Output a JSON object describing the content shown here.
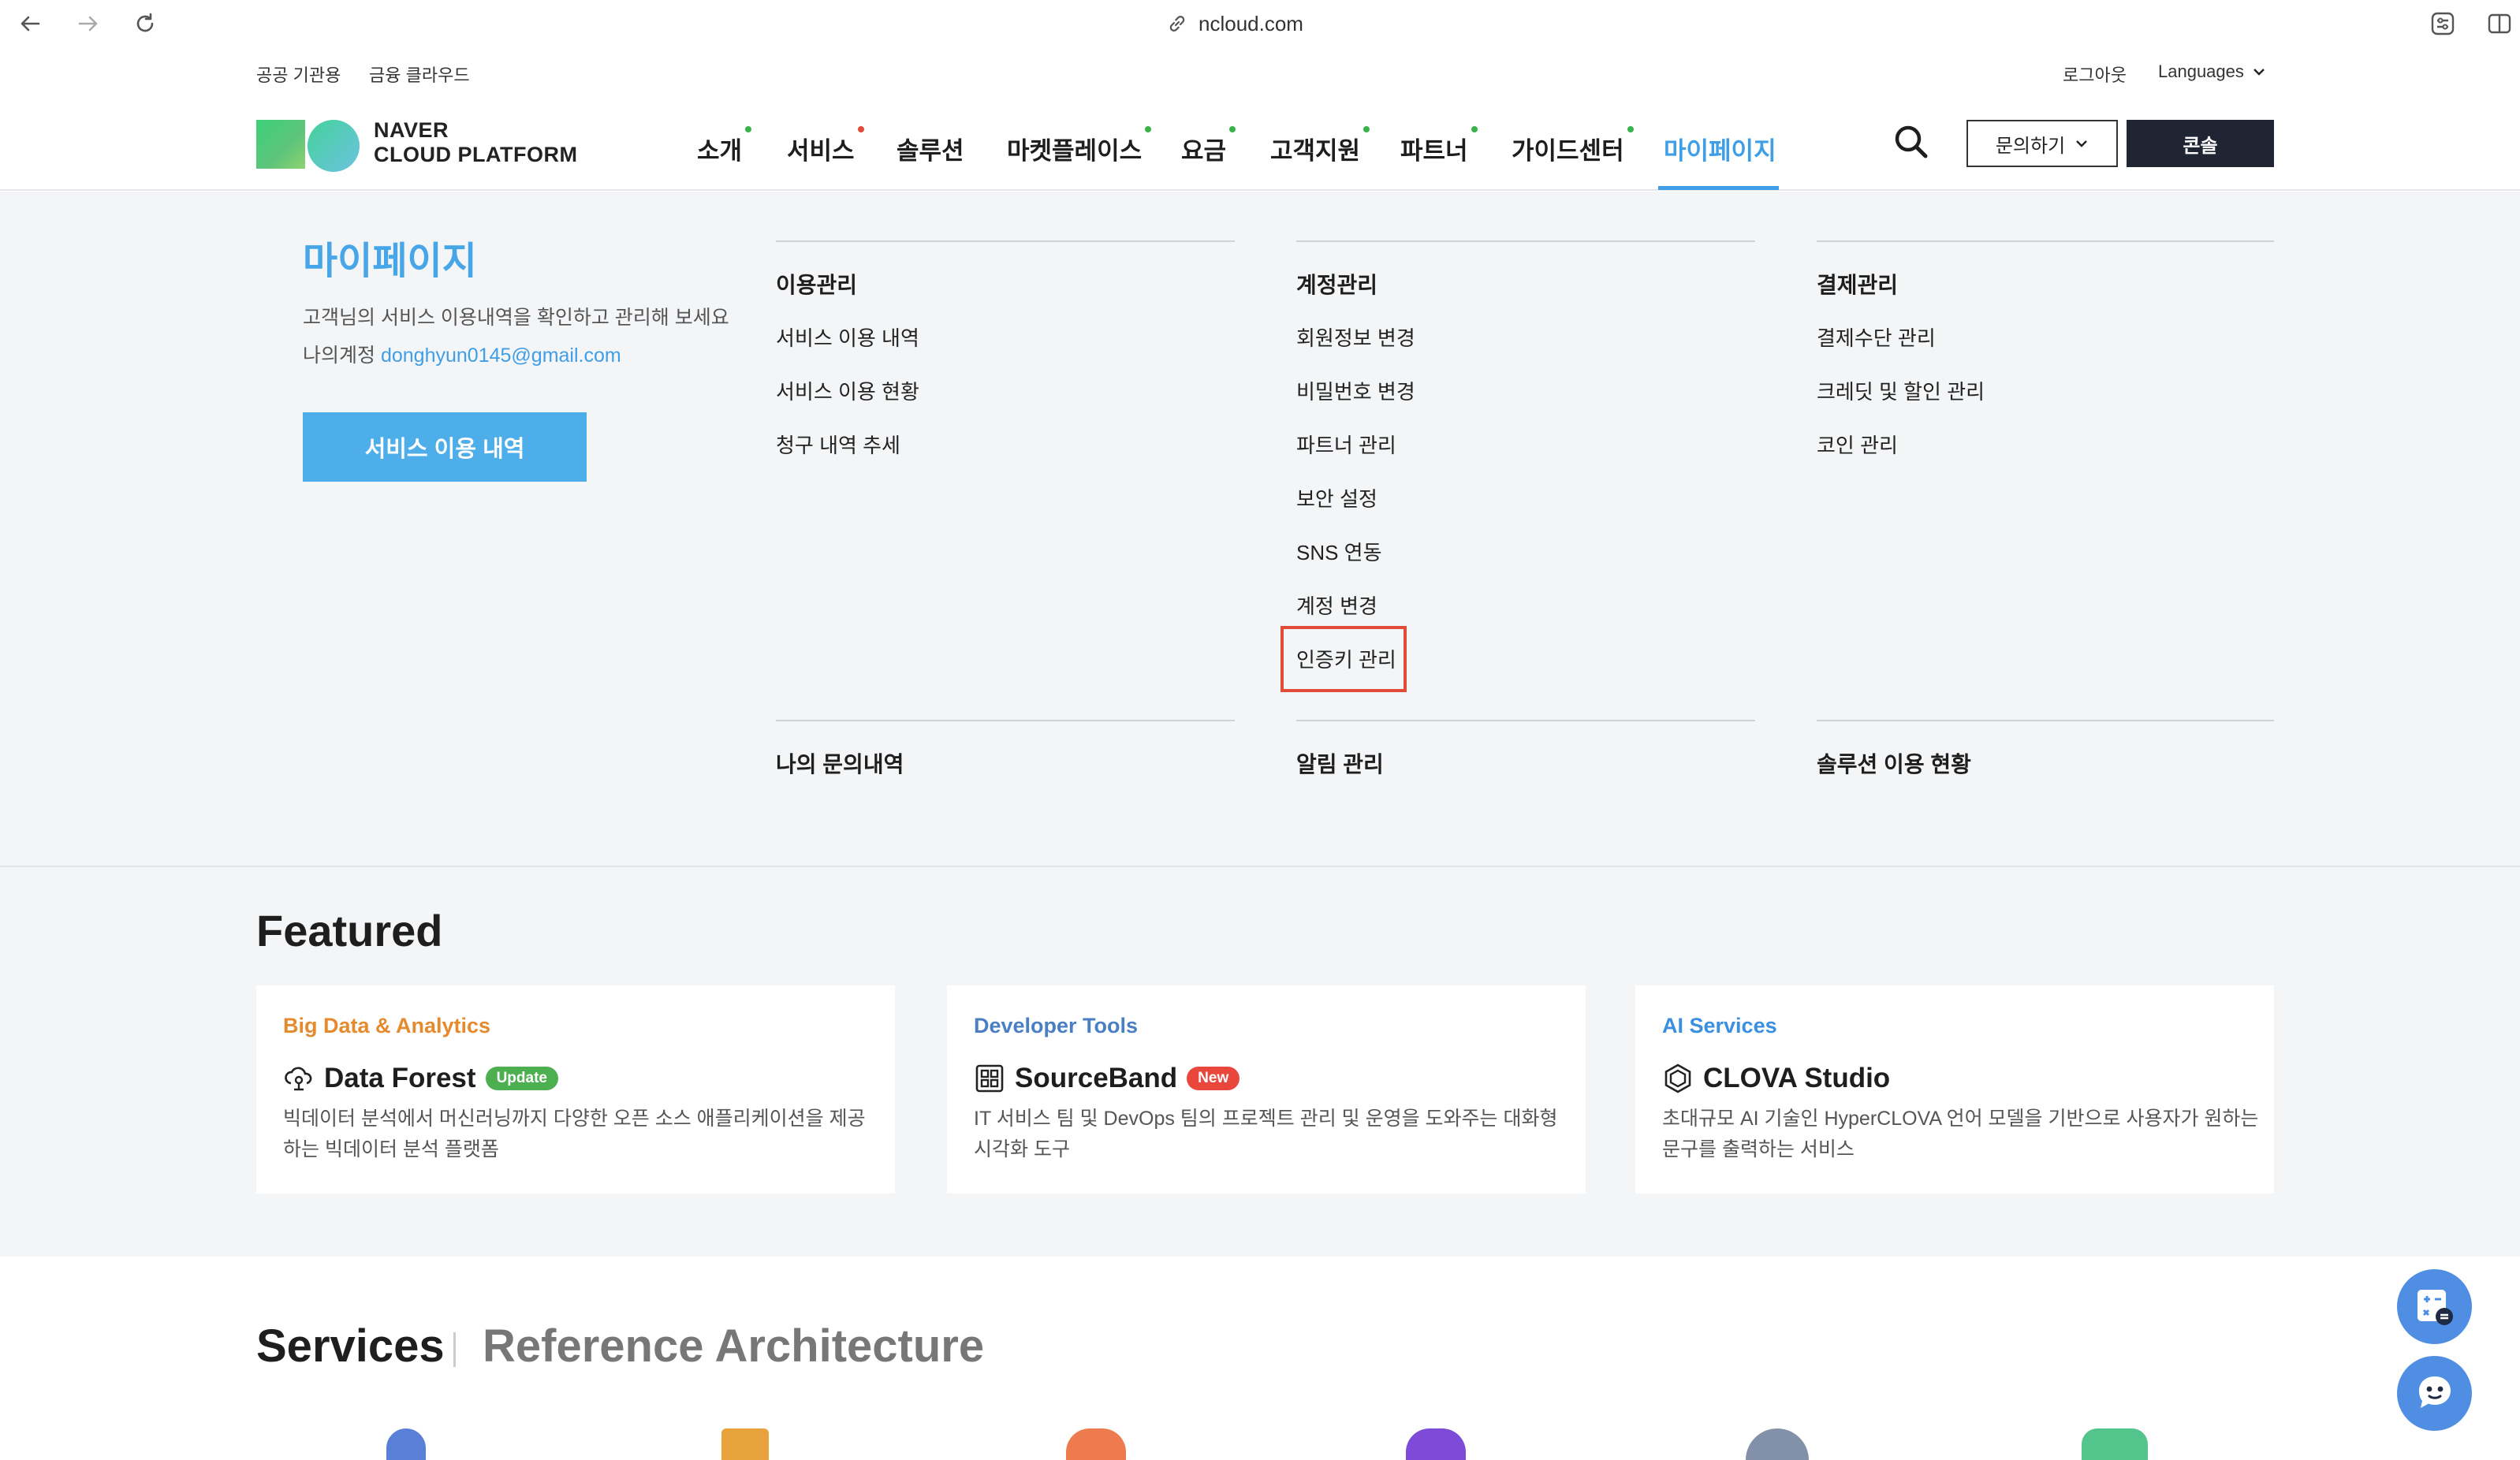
{
  "browser": {
    "url": "ncloud.com"
  },
  "utility": {
    "left_links": [
      "공공 기관용",
      "금융 클라우드"
    ],
    "logout": "로그아웃",
    "languages": "Languages"
  },
  "header": {
    "logo_line1": "NAVER",
    "logo_line2": "CLOUD PLATFORM",
    "menu": [
      {
        "label": "소개",
        "dot": "#38b24a"
      },
      {
        "label": "서비스",
        "dot": "#e04b3a"
      },
      {
        "label": "솔루션",
        "dot": ""
      },
      {
        "label": "마켓플레이스",
        "dot": "#38b24a"
      },
      {
        "label": "요금",
        "dot": "#38b24a"
      },
      {
        "label": "고객지원",
        "dot": "#38b24a"
      },
      {
        "label": "파트너",
        "dot": "#38b24a"
      },
      {
        "label": "가이드센터",
        "dot": "#38b24a"
      },
      {
        "label": "마이페이지",
        "dot": ""
      }
    ],
    "inquiry_label": "문의하기",
    "console_label": "콘솔",
    "accent_color": "#3f9ee6"
  },
  "mypage": {
    "title": "마이페이지",
    "desc": "고객님의 서비스 이용내역을 확인하고 관리해 보세요",
    "account_label": "나의계정",
    "account_email": "donghyun0145@gmail.com",
    "button_label": "서비스 이용 내역",
    "columns": [
      {
        "heading": "이용관리",
        "items": [
          "서비스 이용 내역",
          "서비스 이용 현황",
          "청구 내역 추세"
        ]
      },
      {
        "heading": "계정관리",
        "items": [
          "회원정보 변경",
          "비밀번호 변경",
          "파트너 관리",
          "보안 설정",
          "SNS 연동",
          "계정 변경",
          "인증키 관리"
        ]
      },
      {
        "heading": "결제관리",
        "items": [
          "결제수단 관리",
          "크레딧 및 할인 관리",
          "코인 관리"
        ]
      }
    ],
    "bottom_links": [
      "나의 문의내역",
      "알림 관리",
      "솔루션 이용 현황"
    ]
  },
  "featured": {
    "title": "Featured",
    "cards": [
      {
        "category": "Big Data & Analytics",
        "category_color": "#e68a2e",
        "name": "Data Forest",
        "badge": "Update",
        "badge_color": "#4caf50",
        "icon": "cloud-data-icon",
        "desc": "빅데이터 분석에서 머신러닝까지 다양한 오픈 소스 애플리케이션을 제공하는 빅데이터 분석 플랫폼"
      },
      {
        "category": "Developer Tools",
        "category_color": "#4a7fc4",
        "name": "SourceBand",
        "badge": "New",
        "badge_color": "#e9463c",
        "icon": "board-icon",
        "desc": "IT 서비스 팀 및 DevOps 팀의 프로젝트 관리 및 운영을 도와주는 대화형 시각화 도구"
      },
      {
        "category": "AI Services",
        "category_color": "#3a8fe0",
        "name": "CLOVA Studio",
        "badge": "",
        "badge_color": "",
        "icon": "hexagon-icon",
        "desc": "초대규모 AI 기술인 HyperCLOVA 언어 모델을 기반으로 사용자가 원하는 문구를 출력하는 서비스"
      }
    ]
  },
  "services": {
    "title": "Services",
    "reference": "Reference Architecture"
  }
}
